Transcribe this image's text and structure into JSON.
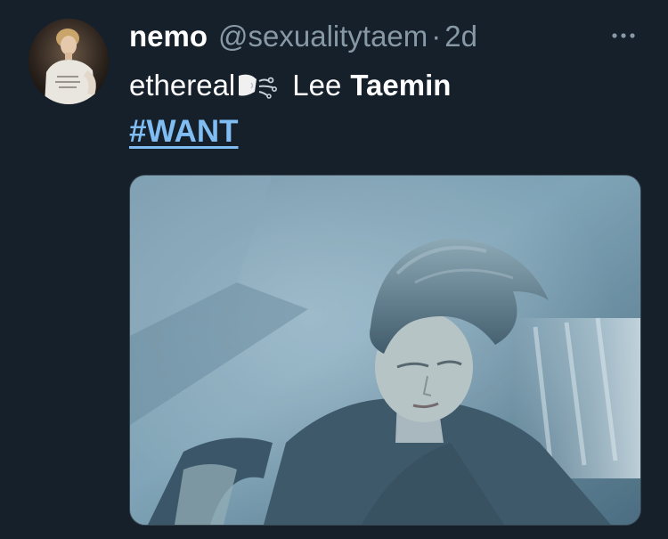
{
  "tweet": {
    "author_name": "nemo",
    "author_handle": "@sexualitytaem",
    "separator": "·",
    "timestamp": "2d",
    "text_part1": "ethereal",
    "emoji": "wind-face-emoji",
    "text_part2": "Lee",
    "text_part3": "Taemin",
    "hashtag": "#WANT",
    "colors": {
      "background": "#15202b",
      "secondary_text": "#8899a6",
      "link": "#7fbdf2"
    }
  }
}
